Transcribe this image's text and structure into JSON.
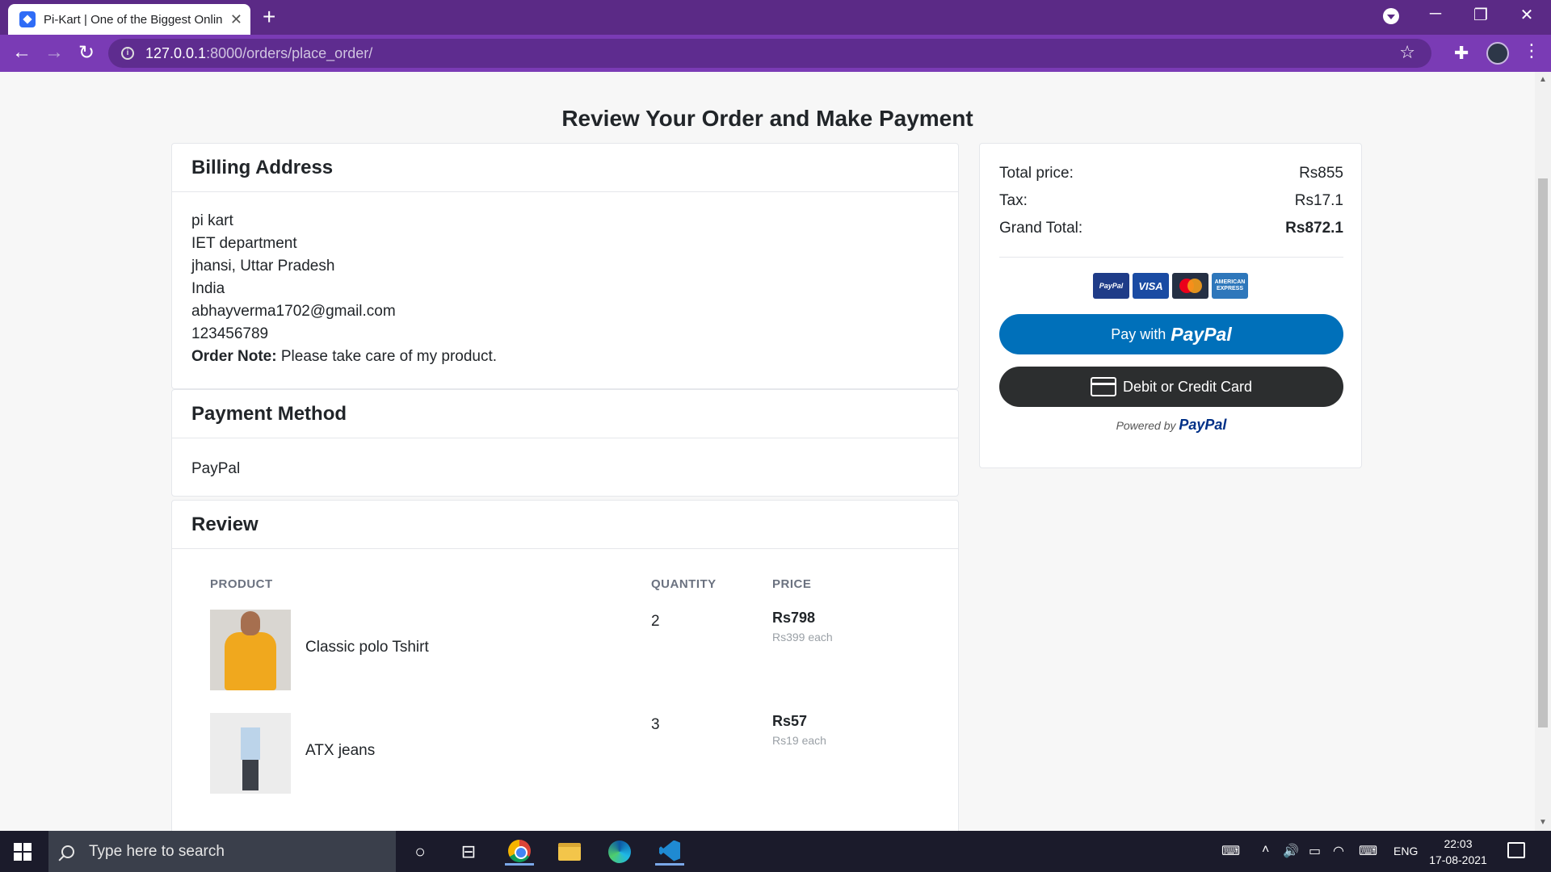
{
  "browser": {
    "tab_title": "Pi-Kart | One of the Biggest Onlin",
    "tab_close": "✕",
    "new_tab": "+",
    "url_host": "127.0.0.1",
    "url_path": ":8000/orders/place_order/"
  },
  "page": {
    "title": "Review Your Order and Make Payment"
  },
  "billing": {
    "header": "Billing Address",
    "name": "pi kart",
    "address1": "IET department",
    "city_state": "jhansi, Uttar Pradesh",
    "country": "India",
    "email": "abhayverma1702@gmail.com",
    "phone": "123456789",
    "note_label": "Order Note:",
    "note_text": "Please take care of my product."
  },
  "payment": {
    "header": "Payment Method",
    "method": "PayPal"
  },
  "review": {
    "header": "Review",
    "columns": [
      "PRODUCT",
      "QUANTITY",
      "PRICE"
    ],
    "items": [
      {
        "name": "Classic polo Tshirt",
        "quantity": "2",
        "price": "Rs798",
        "each": "Rs399 each"
      },
      {
        "name": "ATX jeans",
        "quantity": "3",
        "price": "Rs57",
        "each": "Rs19 each"
      }
    ]
  },
  "summary": {
    "total_label": "Total price:",
    "total_value": "Rs855",
    "tax_label": "Tax:",
    "tax_value": "Rs17.1",
    "grand_label": "Grand Total:",
    "grand_value": "Rs872.1",
    "logos": {
      "paypal": "PayPal",
      "visa": "VISA",
      "amex": "AMERICAN EXPRESS"
    },
    "paypal_button_prefix": "Pay with",
    "paypal_brand": "PayPal",
    "card_button": "Debit or Credit Card",
    "powered_prefix": "Powered by",
    "powered_brand": "PayPal"
  },
  "taskbar": {
    "search_placeholder": "Type here to search",
    "language": "ENG",
    "time": "22:03",
    "date": "17-08-2021"
  }
}
